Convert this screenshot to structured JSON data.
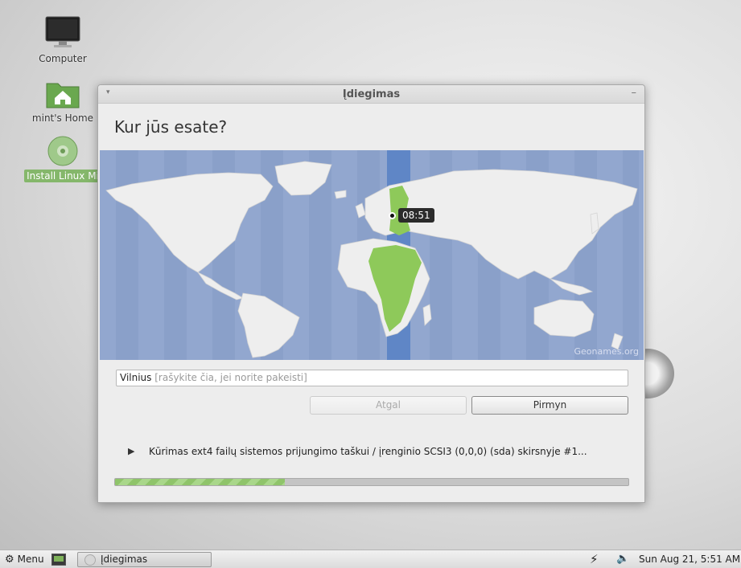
{
  "desktop": {
    "icons": [
      {
        "label": "Computer"
      },
      {
        "label": "mint's Home"
      },
      {
        "label": "Install Linux Mi"
      }
    ]
  },
  "window": {
    "title": "Įdiegimas",
    "heading": "Kur jūs esate?",
    "map": {
      "time": "08:51",
      "credit": "Geonames.org"
    },
    "city": {
      "value": "Vilnius",
      "placeholder": " [rašykite čia, jei norite pakeisti]"
    },
    "buttons": {
      "back": "Atgal",
      "forward": "Pirmyn"
    },
    "status": "Kūrimas ext4 failų sistemos prijungimo taškui / įrenginio SCSI3 (0,0,0) (sda) skirsnyje #1...",
    "progress_percent": 33
  },
  "taskbar": {
    "menu_label": "Menu",
    "task_label": "Įdiegimas",
    "clock": "Sun Aug 21,  5:51 AM"
  },
  "colors": {
    "accent": "#85b76b",
    "map_water": "#92a7cf",
    "timezone_band": "#5f86c6",
    "timezone_land": "#8ec95a"
  }
}
